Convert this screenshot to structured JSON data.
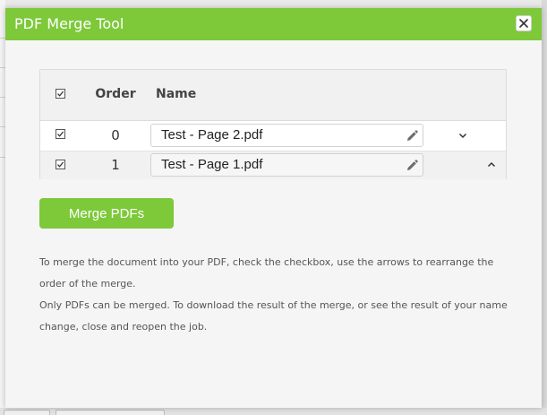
{
  "dialog": {
    "title": "PDF Merge Tool",
    "close_label": "×"
  },
  "table": {
    "headers": {
      "order": "Order",
      "name": "Name"
    },
    "select_all_checked": true,
    "rows": [
      {
        "checked": true,
        "order": "0",
        "name": "Test - Page 2.pdf",
        "arrow": "chevron-down-icon"
      },
      {
        "checked": true,
        "order": "1",
        "name": "Test - Page 1.pdf",
        "arrow": "chevron-up-icon"
      }
    ]
  },
  "merge_button": {
    "label": "Merge PDFs"
  },
  "description": {
    "line1": "To merge the document into your PDF, check the checkbox, use the arrows to rearrange the order of the merge.",
    "line2": "Only PDFs can be merged. To download the result of the merge, or see the result of your name change, close and reopen the job."
  },
  "colors": {
    "accent": "#7dc93a",
    "header_bg": "#f1f1f1",
    "dialog_bg": "#f5f5f5"
  }
}
